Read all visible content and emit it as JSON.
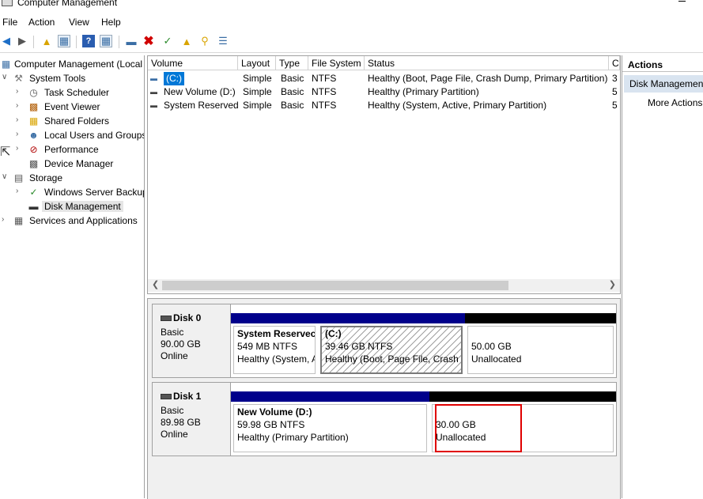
{
  "window": {
    "title": "Computer Management"
  },
  "menubar": {
    "items": [
      "File",
      "Action",
      "View",
      "Help"
    ]
  },
  "tree": {
    "root": "Computer Management (Local",
    "system_tools": "System Tools",
    "task_scheduler": "Task Scheduler",
    "event_viewer": "Event Viewer",
    "shared_folders": "Shared Folders",
    "local_users": "Local Users and Groups",
    "performance": "Performance",
    "device_manager": "Device Manager",
    "storage": "Storage",
    "backup": "Windows Server Backup",
    "disk_management": "Disk Management",
    "services": "Services and Applications"
  },
  "volume_list": {
    "columns": [
      "Volume",
      "Layout",
      "Type",
      "File System",
      "Status",
      "C"
    ],
    "rows": [
      {
        "volume": "(C:)",
        "layout": "Simple",
        "type": "Basic",
        "fs": "NTFS",
        "status": "Healthy (Boot, Page File, Crash Dump, Primary Partition)",
        "cap": "3"
      },
      {
        "volume": "New Volume (D:)",
        "layout": "Simple",
        "type": "Basic",
        "fs": "NTFS",
        "status": "Healthy (Primary Partition)",
        "cap": "5"
      },
      {
        "volume": "System Reserved",
        "layout": "Simple",
        "type": "Basic",
        "fs": "NTFS",
        "status": "Healthy (System, Active, Primary Partition)",
        "cap": "5"
      }
    ]
  },
  "disks": [
    {
      "name": "Disk 0",
      "type": "Basic",
      "size": "90.00 GB",
      "status": "Online",
      "partitions": [
        {
          "title": "System Reservec",
          "line1": "549 MB NTFS",
          "line2": "Healthy (System, A"
        },
        {
          "title": "(C:)",
          "line1": "39.46 GB NTFS",
          "line2": "Healthy (Boot, Page File, Crash D"
        },
        {
          "title": "",
          "line1": "50.00 GB",
          "line2": "Unallocated"
        }
      ]
    },
    {
      "name": "Disk 1",
      "type": "Basic",
      "size": "89.98 GB",
      "status": "Online",
      "partitions": [
        {
          "title": "New Volume  (D:)",
          "line1": "59.98 GB NTFS",
          "line2": "Healthy (Primary Partition)"
        },
        {
          "title": "",
          "line1": "30.00 GB",
          "line2": "Unallocated"
        }
      ]
    }
  ],
  "actions": {
    "header": "Actions",
    "section": "Disk Management",
    "more": "More Actions"
  },
  "colors": {
    "primary_partition": "#00008b",
    "unallocated": "#000000",
    "highlight": "#e00000",
    "selection": "#0078d7"
  }
}
